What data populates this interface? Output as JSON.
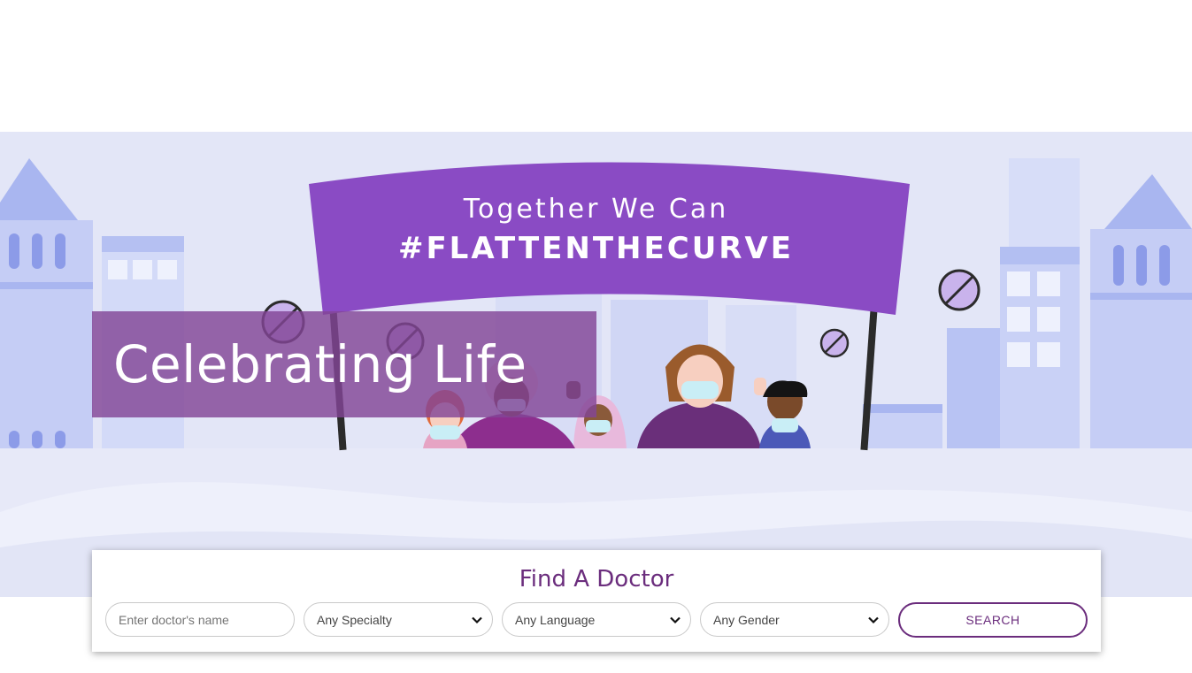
{
  "hero": {
    "banner_line1": "Together We Can",
    "banner_line2": "#FLATTENTHECURVE",
    "title": "Celebrating Life"
  },
  "finder": {
    "title": "Find A Doctor",
    "name_placeholder": "Enter doctor's name",
    "specialty_selected": "Any Specialty",
    "language_selected": "Any Language",
    "gender_selected": "Any Gender",
    "search_label": "SEARCH"
  },
  "colors": {
    "brand_purple": "#6b2d7d",
    "banner_purple": "#8a4bc4",
    "hero_bg": "#e3e6f7"
  },
  "icons": [
    "chevron-down-icon",
    "no-virus-icon"
  ]
}
